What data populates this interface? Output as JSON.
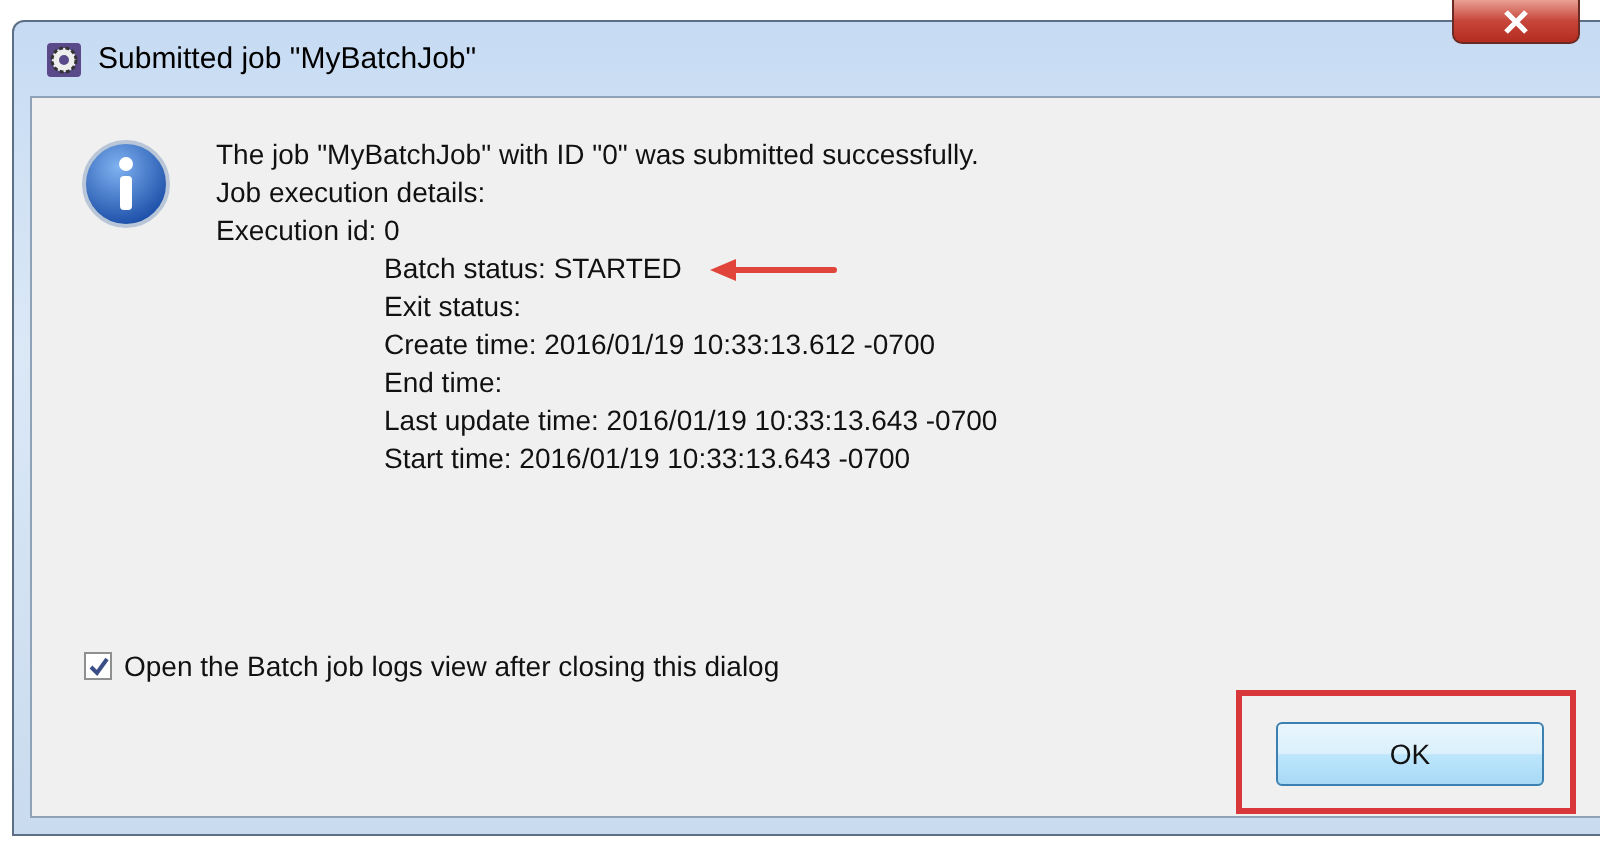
{
  "window": {
    "title": "Submitted job \"MyBatchJob\""
  },
  "lines": [
    {
      "text": "The job \"MyBatchJob\" with ID \"0\" was submitted successfully.",
      "kind": "plain",
      "marked": false
    },
    {
      "text": "Job execution details:",
      "kind": "plain",
      "marked": false
    },
    {
      "text": "Execution id: 0",
      "kind": "plain",
      "marked": false
    },
    {
      "text": "Batch status: STARTED",
      "kind": "indented",
      "marked": true
    },
    {
      "text": "Exit status:",
      "kind": "indented",
      "marked": false
    },
    {
      "text": "Create time: 2016/01/19 10:33:13.612 -0700",
      "kind": "indented",
      "marked": false
    },
    {
      "text": "End time:",
      "kind": "indented",
      "marked": false
    },
    {
      "text": "Last update time: 2016/01/19 10:33:13.643 -0700",
      "kind": "indented",
      "marked": false
    },
    {
      "text": "Start time: 2016/01/19 10:33:13.643 -0700",
      "kind": "indented",
      "marked": false
    }
  ],
  "checkbox": {
    "label": "Open the Batch job logs view after closing this dialog",
    "checked": true
  },
  "buttons": [
    {
      "label": "OK",
      "highlighted": true
    }
  ]
}
